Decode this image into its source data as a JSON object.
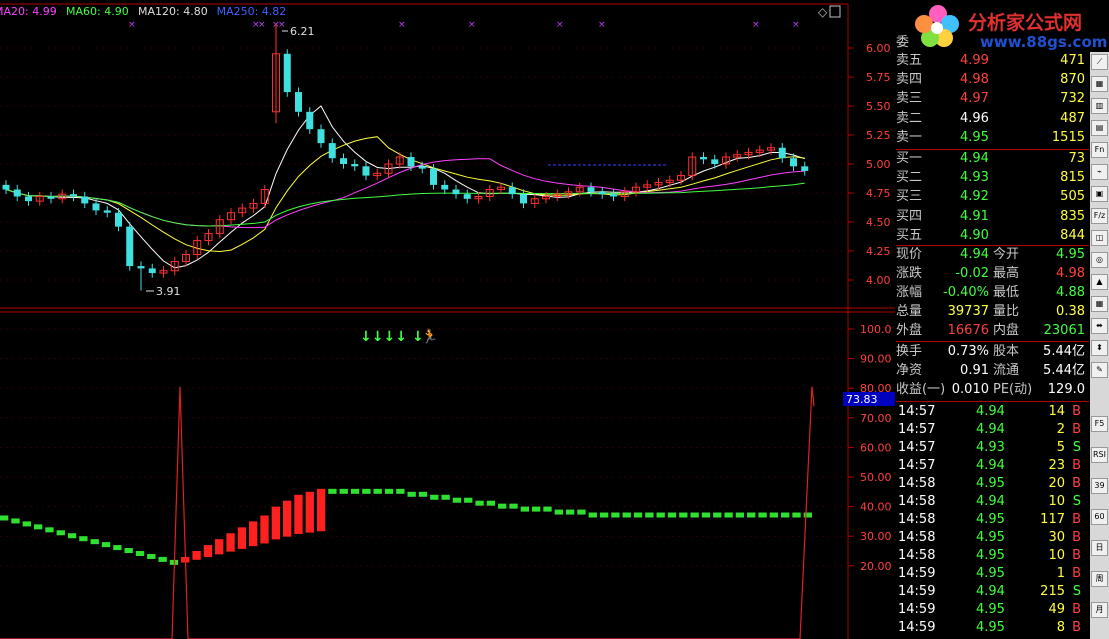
{
  "ma_legend": [
    {
      "label": "MA20: 4.99",
      "color": "#ff40ff"
    },
    {
      "label": "MA60: 4.90",
      "color": "#40ff40"
    },
    {
      "label": "MA120: 4.80",
      "color": "#dddddd"
    },
    {
      "label": "MA250: 4.82",
      "color": "#4060ff"
    }
  ],
  "price_axis": [
    "6.00",
    "5.75",
    "5.50",
    "5.25",
    "5.00",
    "4.75",
    "4.50",
    "4.25",
    "4.00"
  ],
  "indicator_axis": [
    "100.0",
    "90.00",
    "80.00",
    "70.00",
    "60.00",
    "50.00",
    "40.00",
    "30.00",
    "20.00"
  ],
  "indicator_current": "73.83",
  "price_high_label": "6.21",
  "price_low_label": "3.91",
  "logo": {
    "name": "分析家公式网",
    "url": "www.88gs.com"
  },
  "order_book": {
    "title": "委",
    "asks": [
      {
        "label": "卖五",
        "price": "4.99",
        "vol": "471",
        "color": "#ff4040"
      },
      {
        "label": "卖四",
        "price": "4.98",
        "vol": "870",
        "color": "#ff4040"
      },
      {
        "label": "卖三",
        "price": "4.97",
        "vol": "732",
        "color": "#ff4040"
      },
      {
        "label": "卖二",
        "price": "4.96",
        "vol": "487",
        "color": "#ffffff"
      },
      {
        "label": "卖一",
        "price": "4.95",
        "vol": "1515",
        "color": "#40ff40"
      }
    ],
    "bids": [
      {
        "label": "买一",
        "price": "4.94",
        "vol": "73",
        "color": "#40ff40"
      },
      {
        "label": "买二",
        "price": "4.93",
        "vol": "815",
        "color": "#40ff40"
      },
      {
        "label": "买三",
        "price": "4.92",
        "vol": "505",
        "color": "#40ff40"
      },
      {
        "label": "买四",
        "price": "4.91",
        "vol": "835",
        "color": "#40ff40"
      },
      {
        "label": "买五",
        "price": "4.90",
        "vol": "844",
        "color": "#40ff40"
      }
    ]
  },
  "quote": [
    {
      "l1": "现价",
      "v1": "4.94",
      "c1": "#40ff40",
      "l2": "今开",
      "v2": "4.95",
      "c2": "#40ff40"
    },
    {
      "l1": "涨跌",
      "v1": "-0.02",
      "c1": "#40ff40",
      "l2": "最高",
      "v2": "4.98",
      "c2": "#ff4040"
    },
    {
      "l1": "涨幅",
      "v1": "-0.40%",
      "c1": "#40ff40",
      "l2": "最低",
      "v2": "4.88",
      "c2": "#40ff40"
    },
    {
      "l1": "总量",
      "v1": "39737",
      "c1": "#ffff40",
      "l2": "量比",
      "v2": "0.38",
      "c2": "#ffff40"
    },
    {
      "l1": "外盘",
      "v1": "16676",
      "c1": "#ff4040",
      "l2": "内盘",
      "v2": "23061",
      "c2": "#40ff40"
    }
  ],
  "fundamentals": [
    {
      "l1": "换手",
      "v1": "0.73%",
      "l2": "股本",
      "v2": "5.44亿"
    },
    {
      "l1": "净资",
      "v1": "0.91",
      "l2": "流通",
      "v2": "5.44亿"
    },
    {
      "l1": "收益(一)",
      "v1": "0.010",
      "l2": "PE(动)",
      "v2": "129.0"
    }
  ],
  "ticks": [
    {
      "t": "14:57",
      "p": "4.94",
      "v": "14",
      "s": "B"
    },
    {
      "t": "14:57",
      "p": "4.94",
      "v": "2",
      "s": "B"
    },
    {
      "t": "14:57",
      "p": "4.93",
      "v": "5",
      "s": "S"
    },
    {
      "t": "14:57",
      "p": "4.94",
      "v": "23",
      "s": "B"
    },
    {
      "t": "14:58",
      "p": "4.95",
      "v": "20",
      "s": "B"
    },
    {
      "t": "14:58",
      "p": "4.94",
      "v": "10",
      "s": "S"
    },
    {
      "t": "14:58",
      "p": "4.95",
      "v": "117",
      "s": "B"
    },
    {
      "t": "14:58",
      "p": "4.95",
      "v": "30",
      "s": "B"
    },
    {
      "t": "14:58",
      "p": "4.95",
      "v": "10",
      "s": "B"
    },
    {
      "t": "14:59",
      "p": "4.95",
      "v": "1",
      "s": "B"
    },
    {
      "t": "14:59",
      "p": "4.94",
      "v": "215",
      "s": "S"
    },
    {
      "t": "14:59",
      "p": "4.95",
      "v": "49",
      "s": "B"
    },
    {
      "t": "14:59",
      "p": "4.95",
      "v": "8",
      "s": "B"
    }
  ],
  "toolbar": [
    "F5",
    "RSI",
    "39",
    "60",
    "日",
    "周",
    "月"
  ],
  "chart_data": [
    {
      "type": "candlestick",
      "title": "",
      "ylim": [
        3.8,
        6.3
      ],
      "yticks": [
        6.0,
        5.75,
        5.5,
        5.25,
        5.0,
        4.75,
        4.5,
        4.25,
        4.0
      ],
      "high": 6.21,
      "low": 3.91,
      "close_approx": [
        4.78,
        4.72,
        4.68,
        4.72,
        4.7,
        4.74,
        4.72,
        4.66,
        4.6,
        4.58,
        4.46,
        4.12,
        4.1,
        4.06,
        4.08,
        4.16,
        4.22,
        4.34,
        4.4,
        4.52,
        4.58,
        4.62,
        4.66,
        4.78,
        5.95,
        5.62,
        5.45,
        5.3,
        5.18,
        5.05,
        5.0,
        4.98,
        4.9,
        4.92,
        5.0,
        5.06,
        4.98,
        4.96,
        4.82,
        4.78,
        4.74,
        4.7,
        4.72,
        4.78,
        4.8,
        4.74,
        4.66,
        4.7,
        4.72,
        4.74,
        4.76,
        4.8,
        4.76,
        4.74,
        4.72,
        4.76,
        4.8,
        4.82,
        4.84,
        4.86,
        4.9,
        5.06,
        5.04,
        5.0,
        5.06,
        5.08,
        5.1,
        5.12,
        5.14,
        5.05,
        4.98,
        4.94
      ]
    },
    {
      "type": "bar",
      "title": "",
      "ylim": [
        0,
        105
      ],
      "yticks": [
        100,
        90,
        80,
        70,
        60,
        50,
        40,
        30,
        20
      ],
      "current": 73.83,
      "values_approx": [
        37,
        36,
        35,
        34,
        33,
        32,
        31,
        30,
        29,
        28,
        27,
        26,
        25,
        24,
        23,
        22,
        23,
        25,
        27,
        29,
        31,
        33,
        35,
        37,
        40,
        42,
        44,
        45,
        46,
        46,
        46,
        46,
        46,
        46,
        46,
        46,
        45,
        45,
        44,
        44,
        43,
        43,
        42,
        42,
        41,
        41,
        40,
        40,
        40,
        39,
        39,
        39,
        38,
        38,
        38,
        38,
        38,
        38,
        38,
        38,
        38,
        38,
        38,
        38,
        38,
        38,
        38,
        38,
        38,
        38,
        38,
        38
      ]
    }
  ]
}
